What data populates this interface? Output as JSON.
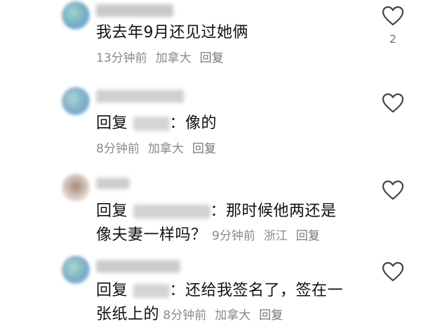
{
  "comments": [
    {
      "text": "我去年9月还见过她俩",
      "time": "13分钟前",
      "location": "加拿大",
      "reply_label": "回复",
      "likes": "2"
    },
    {
      "reply_prefix": "回复",
      "text": "：像的",
      "time": "8分钟前",
      "location": "加拿大",
      "reply_label": "回复"
    },
    {
      "reply_prefix": "回复",
      "text_line1": "：那时候他两还是",
      "text_line2": "像夫妻一样吗？",
      "time": "9分钟前",
      "location": "浙江",
      "reply_label": "回复"
    },
    {
      "reply_prefix": "回复",
      "text_line1": "：还给我签名了，签在一",
      "text_line2": "张纸上的",
      "time": "8分钟前",
      "location": "加拿大",
      "reply_label": "回复"
    }
  ],
  "colors": {
    "text": "#111111",
    "meta": "#8a8a8a",
    "heart_stroke": "#444444"
  },
  "icons": [
    "heart-icon"
  ]
}
